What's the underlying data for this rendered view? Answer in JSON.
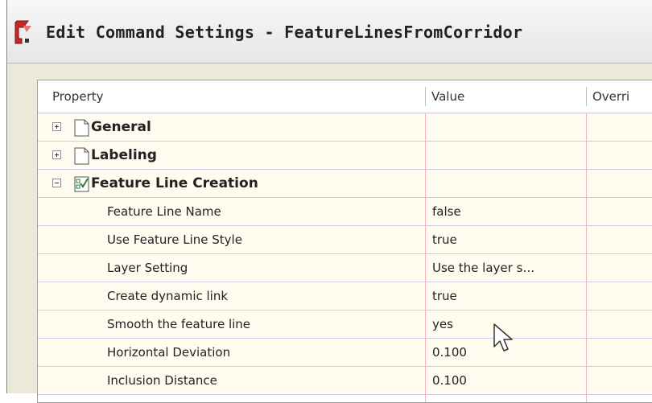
{
  "window": {
    "title": "Edit Command Settings - FeatureLinesFromCorridor"
  },
  "grid": {
    "columns": [
      "Property",
      "Value",
      "Overri"
    ],
    "categories": [
      {
        "label": "General",
        "expanded": false,
        "icon": "document-icon"
      },
      {
        "label": "Labeling",
        "expanded": false,
        "icon": "document-icon"
      },
      {
        "label": "Feature Line Creation",
        "expanded": true,
        "icon": "checklist-icon"
      }
    ],
    "rows": [
      {
        "property": "Feature Line Name",
        "value": "false"
      },
      {
        "property": "Use Feature Line Style",
        "value": "true"
      },
      {
        "property": "Layer Setting",
        "value": "Use the layer s…"
      },
      {
        "property": "Create dynamic link",
        "value": "true"
      },
      {
        "property": "Smooth the feature line",
        "value": "yes"
      },
      {
        "property": "Horizontal Deviation",
        "value": "0.100"
      },
      {
        "property": "Inclusion Distance",
        "value": "0.100"
      }
    ]
  },
  "colors": {
    "row_background": "#fffbef",
    "row_divider": "#cccce8",
    "column_divider": "#f2b8c8",
    "window_chrome": "#ece9d8"
  }
}
